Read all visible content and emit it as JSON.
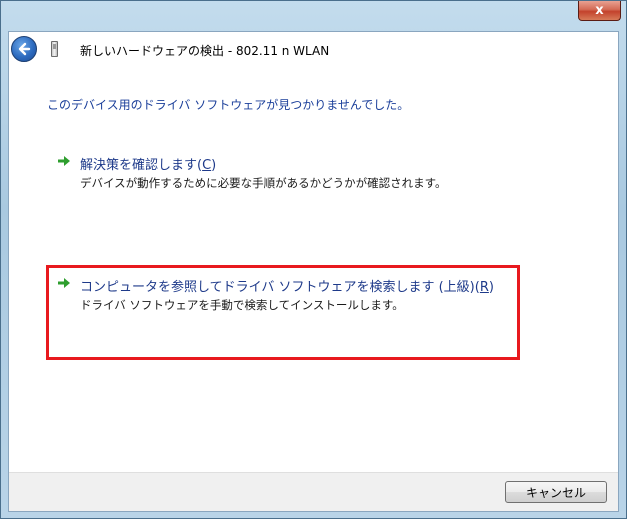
{
  "window": {
    "close_label": "x"
  },
  "dialog": {
    "title": "新しいハードウェアの検出 - 802.11 n WLAN",
    "heading": "このデバイス用のドライバ ソフトウェアが見つかりませんでした。"
  },
  "options": [
    {
      "title": "解決策を確認します",
      "key": "C",
      "description": "デバイスが動作するために必要な手順があるかどうかが確認されます。"
    },
    {
      "title": "コンピュータを参照してドライバ ソフトウェアを検索します (上級)",
      "key": "R",
      "description": "ドライバ ソフトウェアを手動で検索してインストールします。"
    }
  ],
  "footer": {
    "cancel_label": "キャンセル"
  },
  "colors": {
    "link_blue": "#1e3a8a",
    "heading_blue": "#1b3f9a",
    "arrow_green": "#2e9e2e",
    "highlight_red": "#e8191e"
  }
}
